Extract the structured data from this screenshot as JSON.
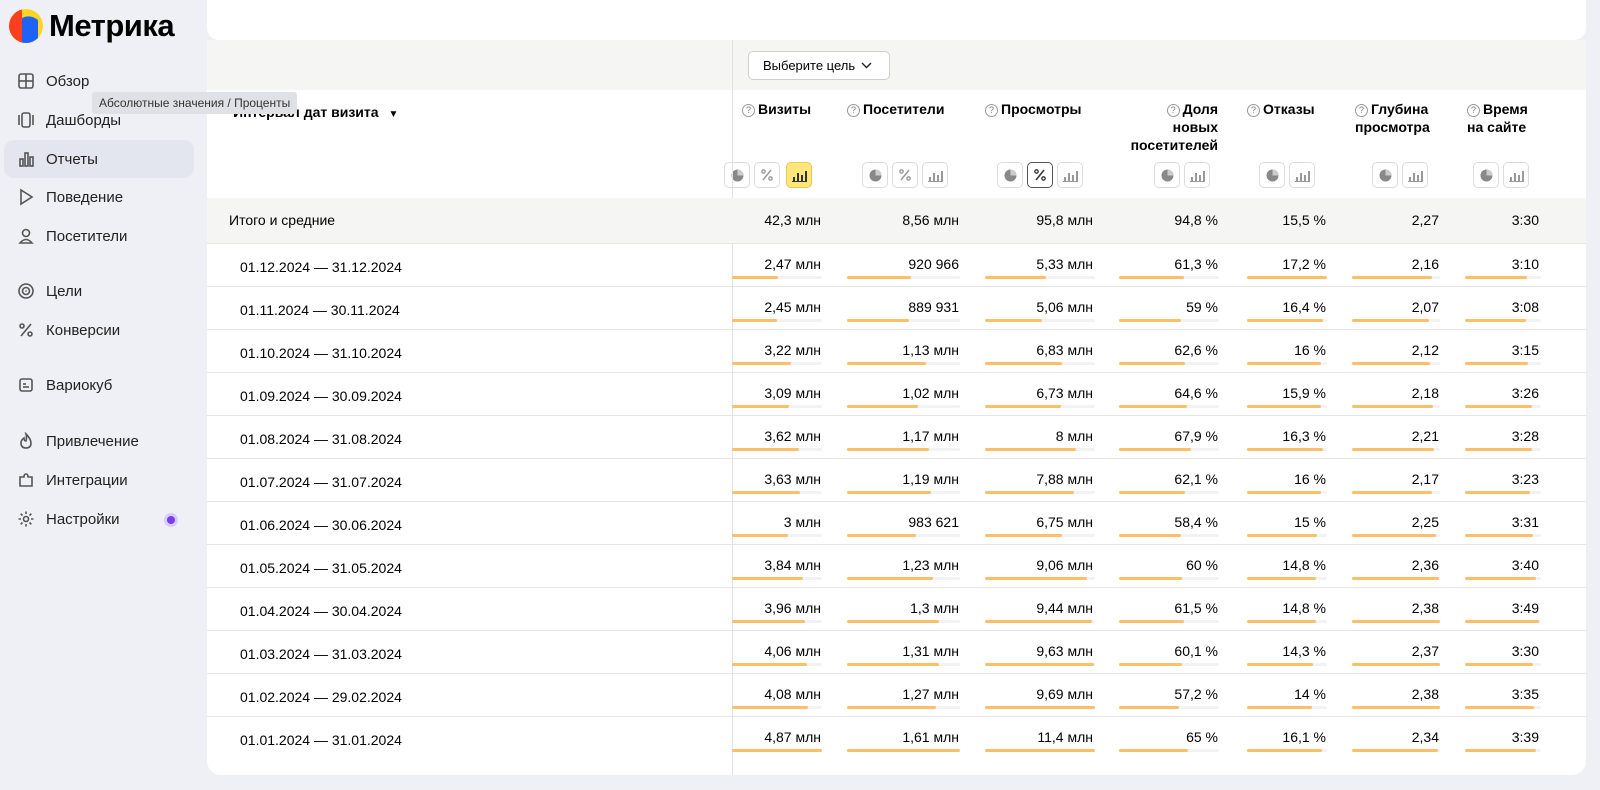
{
  "app": {
    "name": "Метрика",
    "brand_colors": [
      "#fc3f1d",
      "#1e63f5",
      "#ffd426"
    ]
  },
  "sidebar": {
    "items": [
      {
        "label": "Обзор",
        "icon": "grid-icon",
        "active": false
      },
      {
        "label": "Дашборды",
        "icon": "dashboard-icon",
        "active": false
      },
      {
        "label": "Отчеты",
        "icon": "bar-chart-icon",
        "active": true
      },
      {
        "label": "Поведение",
        "icon": "play-icon",
        "active": false
      },
      {
        "label": "Посетители",
        "icon": "user-icon",
        "active": false
      },
      {
        "label": "Цели",
        "icon": "target-icon",
        "active": false
      },
      {
        "label": "Конверсии",
        "icon": "percent-icon",
        "active": false
      },
      {
        "label": "Вариокуб",
        "icon": "variocube-icon",
        "active": false
      },
      {
        "label": "Привлечение",
        "icon": "flame-icon",
        "active": false
      },
      {
        "label": "Интеграции",
        "icon": "puzzle-icon",
        "active": false
      },
      {
        "label": "Настройки",
        "icon": "gear-icon",
        "active": false,
        "badge_color": "#7a3cf5"
      }
    ]
  },
  "goal_select": {
    "label": "Выберите цель"
  },
  "tooltip": {
    "text": "Абсолютные значения / Проценты"
  },
  "table": {
    "dimension_header": "Интервал дат визита",
    "sort_indicator": "▼",
    "columns": [
      {
        "key": "visits",
        "header_lines": [
          "Визиты"
        ],
        "mode": "absolute"
      },
      {
        "key": "visitors",
        "header_lines": [
          "Посетители"
        ],
        "mode": "none"
      },
      {
        "key": "views",
        "header_lines": [
          "Просмотры"
        ],
        "mode": "percent"
      },
      {
        "key": "new_share",
        "header_lines": [
          "Доля",
          "новых",
          "посетителей"
        ],
        "mode": "none"
      },
      {
        "key": "bounces",
        "header_lines": [
          "Отказы"
        ],
        "mode": "none"
      },
      {
        "key": "depth",
        "header_lines": [
          "Глубина",
          "просмотра"
        ],
        "mode": "none"
      },
      {
        "key": "time",
        "header_lines": [
          "Время",
          "на сайте"
        ],
        "mode": "none"
      }
    ],
    "totals": {
      "label": "Итого и средние",
      "values": [
        "42,3 млн",
        "8,56 млн",
        "95,8 млн",
        "94,8 %",
        "15,5 %",
        "2,27",
        "3:30"
      ]
    },
    "rows": [
      {
        "label": "01.12.2024 — 31.12.2024",
        "values": [
          "2,47 млн",
          "920 966",
          "5,33 млн",
          "61,3 %",
          "17,2 %",
          "2,16",
          "3:10"
        ],
        "bars": [
          0.51,
          0.57,
          0.55,
          0.65,
          1.0,
          0.91,
          0.81
        ]
      },
      {
        "label": "01.11.2024 — 30.11.2024",
        "values": [
          "2,45 млн",
          "889 931",
          "5,06 млн",
          "59 %",
          "16,4 %",
          "2,07",
          "3:08"
        ],
        "bars": [
          0.5,
          0.55,
          0.52,
          0.62,
          0.95,
          0.87,
          0.8
        ]
      },
      {
        "label": "01.10.2024 — 31.10.2024",
        "values": [
          "3,22 млн",
          "1,13 млн",
          "6,83 млн",
          "62,6 %",
          "16 %",
          "2,12",
          "3:15"
        ],
        "bars": [
          0.66,
          0.7,
          0.7,
          0.66,
          0.93,
          0.89,
          0.83
        ]
      },
      {
        "label": "01.09.2024 — 30.09.2024",
        "values": [
          "3,09 млн",
          "1,02 млн",
          "6,73 млн",
          "64,6 %",
          "15,9 %",
          "2,18",
          "3:26"
        ],
        "bars": [
          0.63,
          0.63,
          0.69,
          0.68,
          0.92,
          0.92,
          0.88
        ]
      },
      {
        "label": "01.08.2024 — 31.08.2024",
        "values": [
          "3,62 млн",
          "1,17 млн",
          "8 млн",
          "67,9 %",
          "16,3 %",
          "2,21",
          "3:28"
        ],
        "bars": [
          0.74,
          0.73,
          0.83,
          0.72,
          0.95,
          0.93,
          0.88
        ]
      },
      {
        "label": "01.07.2024 — 31.07.2024",
        "values": [
          "3,63 млн",
          "1,19 млн",
          "7,88 млн",
          "62,1 %",
          "16 %",
          "2,17",
          "3:23"
        ],
        "bars": [
          0.75,
          0.74,
          0.81,
          0.66,
          0.93,
          0.91,
          0.86
        ]
      },
      {
        "label": "01.06.2024 — 30.06.2024",
        "values": [
          "3 млн",
          "983 621",
          "6,75 млн",
          "58,4 %",
          "15 %",
          "2,25",
          "3:31"
        ],
        "bars": [
          0.62,
          0.61,
          0.7,
          0.62,
          0.87,
          0.95,
          0.9
        ]
      },
      {
        "label": "01.05.2024 — 31.05.2024",
        "values": [
          "3,84 млн",
          "1,23 млн",
          "9,06 млн",
          "60 %",
          "14,8 %",
          "2,36",
          "3:40"
        ],
        "bars": [
          0.79,
          0.76,
          0.93,
          0.63,
          0.86,
          0.99,
          0.94
        ]
      },
      {
        "label": "01.04.2024 — 30.04.2024",
        "values": [
          "3,96 млн",
          "1,3 млн",
          "9,44 млн",
          "61,5 %",
          "14,8 %",
          "2,38",
          "3:49"
        ],
        "bars": [
          0.81,
          0.81,
          0.97,
          0.65,
          0.86,
          1.0,
          0.97
        ]
      },
      {
        "label": "01.03.2024 — 31.03.2024",
        "values": [
          "4,06 млн",
          "1,31 млн",
          "9,63 млн",
          "60,1 %",
          "14,3 %",
          "2,37",
          "3:30"
        ],
        "bars": [
          0.83,
          0.81,
          0.99,
          0.63,
          0.83,
          1.0,
          0.89
        ]
      },
      {
        "label": "01.02.2024 — 29.02.2024",
        "values": [
          "4,08 млн",
          "1,27 млн",
          "9,69 млн",
          "57,2 %",
          "14 %",
          "2,38",
          "3:35"
        ],
        "bars": [
          0.84,
          0.79,
          1.0,
          0.6,
          0.81,
          1.0,
          0.91
        ]
      },
      {
        "label": "01.01.2024 — 31.01.2024",
        "values": [
          "4,87 млн",
          "1,61 млн",
          "11,4 млн",
          "65 %",
          "16,1 %",
          "2,34",
          "3:39"
        ],
        "bars": [
          1.0,
          1.0,
          1.0,
          0.69,
          0.94,
          0.98,
          0.93
        ]
      }
    ]
  }
}
